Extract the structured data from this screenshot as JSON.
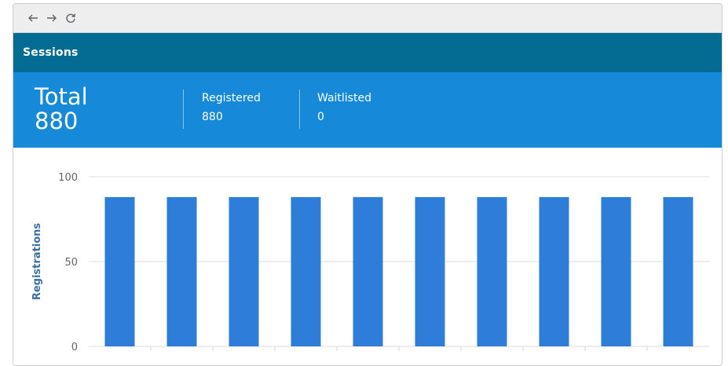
{
  "browser": {
    "icons": [
      "back-arrow-icon",
      "forward-arrow-icon",
      "reload-icon"
    ]
  },
  "header": {
    "title": "Sessions"
  },
  "stats": {
    "total_label": "Total",
    "total_value": "880",
    "registered_label": "Registered",
    "registered_value": "880",
    "waitlisted_label": "Waitlisted",
    "waitlisted_value": "0"
  },
  "colors": {
    "header_bg": "#046b93",
    "stats_bg": "#1689d9",
    "bar": "#2e7dd9"
  },
  "chart_data": {
    "type": "bar",
    "ylabel": "Registrations",
    "xlabel": "",
    "ylim": [
      0,
      100
    ],
    "yticks": [
      0,
      50,
      100
    ],
    "values": [
      88,
      88,
      88,
      88,
      88,
      88,
      88,
      88,
      88,
      88
    ],
    "grid": true
  }
}
